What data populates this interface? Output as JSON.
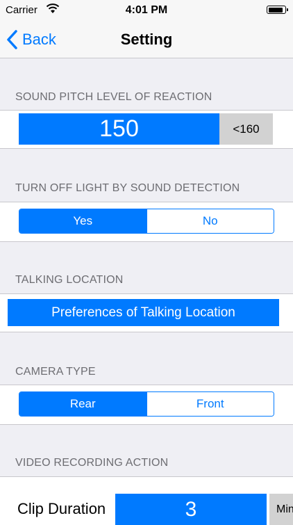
{
  "status_bar": {
    "carrier": "Carrier",
    "time": "4:01 PM",
    "wifi_icon": "wifi-icon",
    "battery_icon": "battery-icon"
  },
  "nav": {
    "back_label": "Back",
    "title": "Setting",
    "back_icon": "chevron-left-icon"
  },
  "sound_pitch": {
    "header": "SOUND PITCH LEVEL OF REACTION",
    "value": "150",
    "badge": "<160"
  },
  "light_off": {
    "header": "TURN OFF LIGHT BY SOUND DETECTION",
    "options": [
      "Yes",
      "No"
    ],
    "selected": "Yes"
  },
  "talking_location": {
    "header": "TALKING LOCATION",
    "button_label": "Preferences of Talking Location"
  },
  "camera_type": {
    "header": "CAMERA TYPE",
    "options": [
      "Rear",
      "Front"
    ],
    "selected": "Rear"
  },
  "video_recording": {
    "header": "VIDEO RECORDING ACTION",
    "clip_label": "Clip Duration",
    "clip_value": "3",
    "clip_unit": "Min"
  },
  "colors": {
    "accent": "#007aff",
    "background": "#efeff4",
    "badge": "#d2d2d2"
  }
}
